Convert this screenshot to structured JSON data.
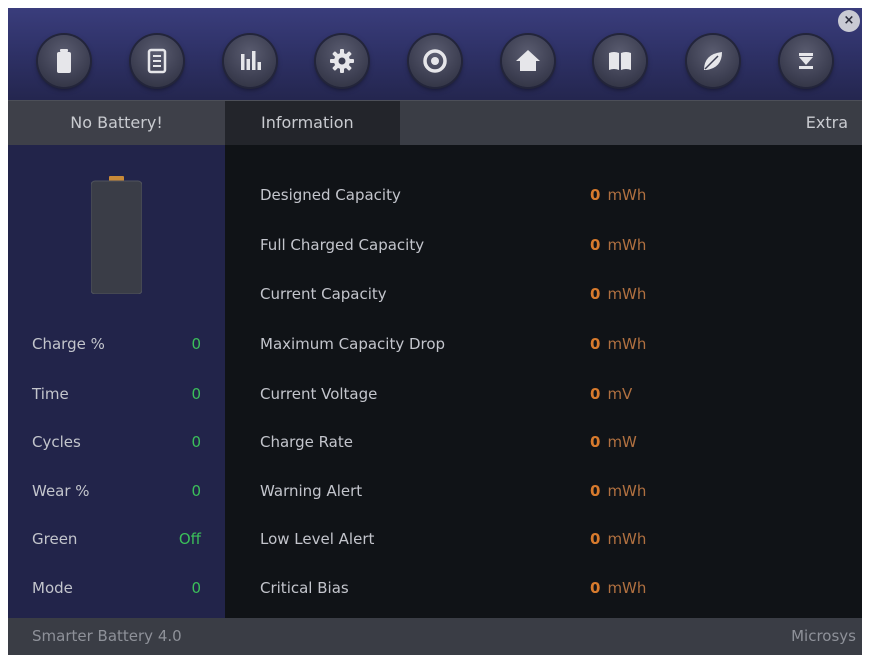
{
  "app": {
    "title": "Smarter Battery 4.0",
    "vendor": "Microsys"
  },
  "toolbar": {
    "buttons": [
      {
        "icon": "battery-icon"
      },
      {
        "icon": "document-icon"
      },
      {
        "icon": "bar-chart-icon"
      },
      {
        "icon": "gear-icon"
      },
      {
        "icon": "ring-icon"
      },
      {
        "icon": "home-icon"
      },
      {
        "icon": "book-icon"
      },
      {
        "icon": "leaf-icon"
      },
      {
        "icon": "minimize-icon"
      }
    ],
    "close_label": "×"
  },
  "tabs": {
    "battery": "No Battery!",
    "information": "Information",
    "extra": "Extra"
  },
  "stats": [
    {
      "label": "Charge %",
      "value": "0"
    },
    {
      "label": "Time",
      "value": "0"
    },
    {
      "label": "Cycles",
      "value": "0"
    },
    {
      "label": "Wear %",
      "value": "0"
    },
    {
      "label": "Green",
      "value": "Off"
    },
    {
      "label": "Mode",
      "value": "0"
    }
  ],
  "info": [
    {
      "label": "Designed Capacity",
      "value": "0",
      "unit": "mWh"
    },
    {
      "label": "Full Charged Capacity",
      "value": "0",
      "unit": "mWh"
    },
    {
      "label": "Current Capacity",
      "value": "0",
      "unit": "mWh"
    },
    {
      "label": "Maximum Capacity Drop",
      "value": "0",
      "unit": "mWh"
    },
    {
      "label": "Current Voltage",
      "value": "0",
      "unit": "mV"
    },
    {
      "label": "Charge Rate",
      "value": "0",
      "unit": "mW"
    },
    {
      "label": "Warning Alert",
      "value": "0",
      "unit": "mWh"
    },
    {
      "label": "Low Level Alert",
      "value": "0",
      "unit": "mWh"
    },
    {
      "label": "Critical Bias",
      "value": "0",
      "unit": "mWh"
    }
  ],
  "colors": {
    "accent_orange": "#d77a2d",
    "status_green": "#3bbf5a",
    "toolbar_blue": "#2e3166"
  }
}
